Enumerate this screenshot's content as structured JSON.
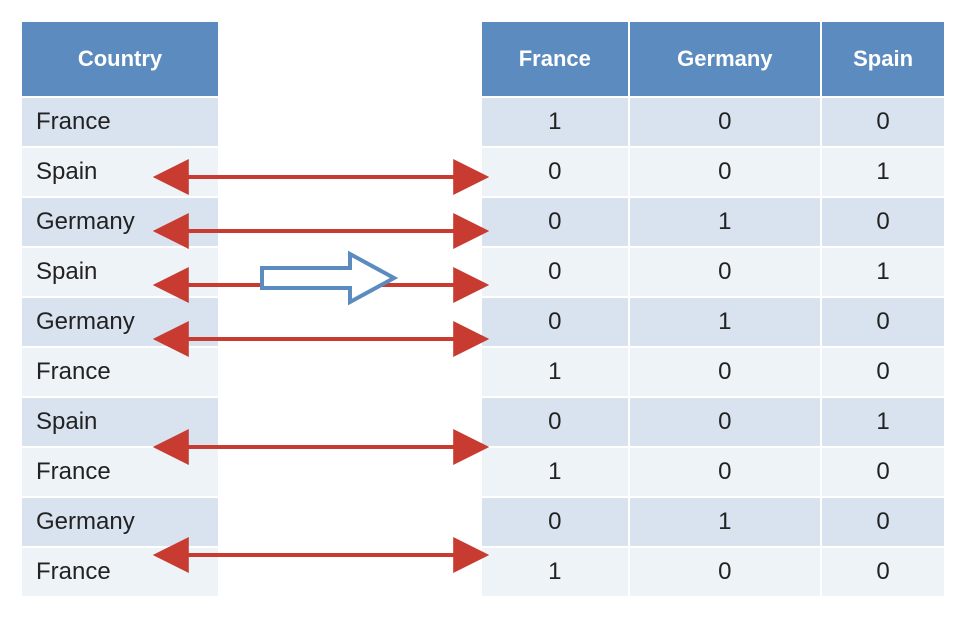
{
  "left": {
    "header": "Country",
    "rows": [
      "France",
      "Spain",
      "Germany",
      "Spain",
      "Germany",
      "France",
      "Spain",
      "France",
      "Germany",
      "France"
    ]
  },
  "right": {
    "headers": [
      "France",
      "Germany",
      "Spain"
    ],
    "rows": [
      [
        1,
        0,
        0
      ],
      [
        0,
        0,
        1
      ],
      [
        0,
        1,
        0
      ],
      [
        0,
        0,
        1
      ],
      [
        0,
        1,
        0
      ],
      [
        1,
        0,
        0
      ],
      [
        0,
        0,
        1
      ],
      [
        1,
        0,
        0
      ],
      [
        0,
        1,
        0
      ],
      [
        1,
        0,
        0
      ]
    ]
  },
  "arrow_color": "#c73b31",
  "big_arrow_stroke": "#5b8bbf",
  "chart_data": {
    "type": "table",
    "title": "One-hot encoding of Country column",
    "input_column": "Country",
    "categories": [
      "France",
      "Germany",
      "Spain"
    ],
    "records": [
      {
        "Country": "France",
        "France": 1,
        "Germany": 0,
        "Spain": 0
      },
      {
        "Country": "Spain",
        "France": 0,
        "Germany": 0,
        "Spain": 1
      },
      {
        "Country": "Germany",
        "France": 0,
        "Germany": 1,
        "Spain": 0
      },
      {
        "Country": "Spain",
        "France": 0,
        "Germany": 0,
        "Spain": 1
      },
      {
        "Country": "Germany",
        "France": 0,
        "Germany": 1,
        "Spain": 0
      },
      {
        "Country": "France",
        "France": 1,
        "Germany": 0,
        "Spain": 0
      },
      {
        "Country": "Spain",
        "France": 0,
        "Germany": 0,
        "Spain": 1
      },
      {
        "Country": "France",
        "France": 1,
        "Germany": 0,
        "Spain": 0
      },
      {
        "Country": "Germany",
        "France": 0,
        "Germany": 1,
        "Spain": 0
      },
      {
        "Country": "France",
        "France": 1,
        "Germany": 0,
        "Spain": 0
      }
    ]
  }
}
